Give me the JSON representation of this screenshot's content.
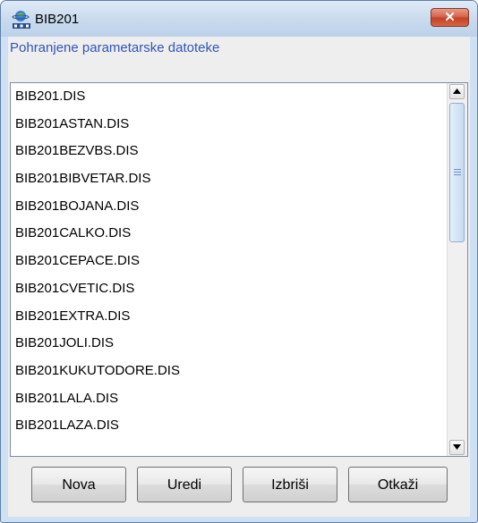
{
  "window": {
    "title": "BIB201",
    "icon": "iss-logo-icon",
    "close_symbol": "✕"
  },
  "section": {
    "label": "Pohranjene parametarske datoteke"
  },
  "files": [
    "BIB201.DIS",
    "BIB201ASTAN.DIS",
    "BIB201BEZVBS.DIS",
    "BIB201BIBVETAR.DIS",
    "BIB201BOJANA.DIS",
    "BIB201CALKO.DIS",
    "BIB201CEPACE.DIS",
    "BIB201CVETIC.DIS",
    "BIB201EXTRA.DIS",
    "BIB201JOLI.DIS",
    "BIB201KUKUTODORE.DIS",
    "BIB201LALA.DIS",
    "BIB201LAZA.DIS"
  ],
  "scroll": {
    "position_fraction": 0.0
  },
  "buttons": {
    "new": "Nova",
    "edit": "Uredi",
    "delete": "Izbriši",
    "cancel": "Otkaži"
  },
  "colors": {
    "frame": "#cfe0f2",
    "label": "#2f55b8",
    "close": "#c24127"
  }
}
